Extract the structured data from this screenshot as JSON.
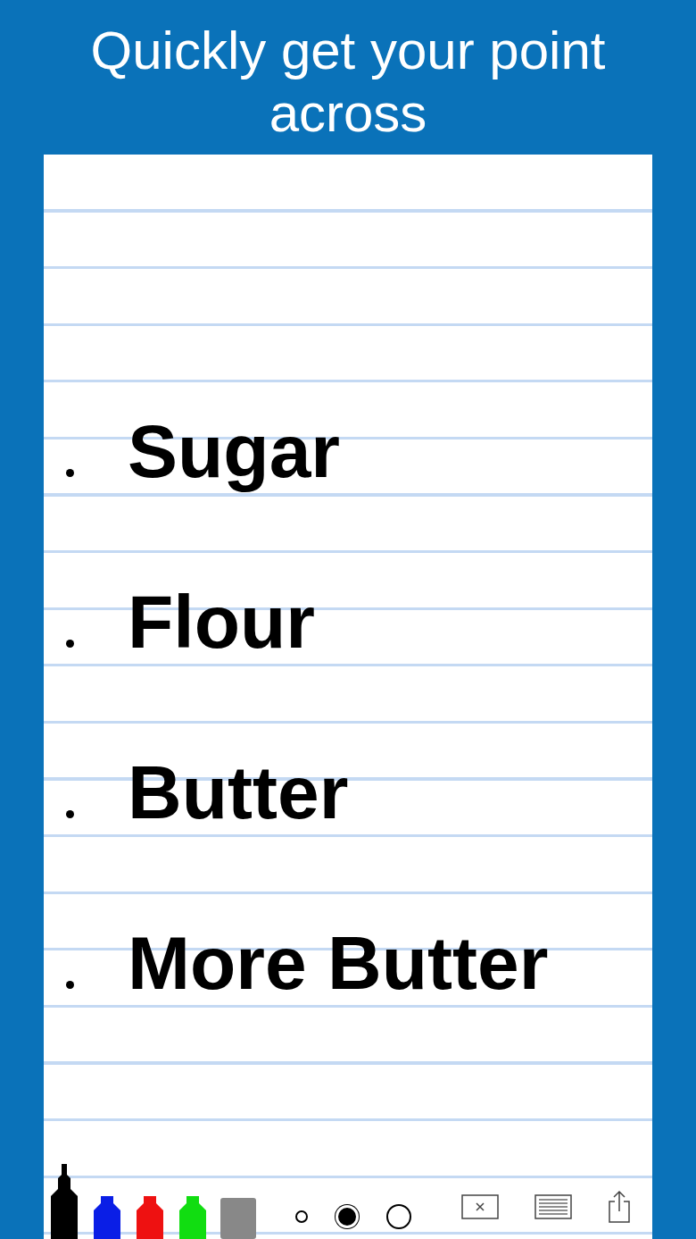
{
  "headline": "Quickly get your point across",
  "notes": [
    {
      "text": "Sugar"
    },
    {
      "text": "Flour"
    },
    {
      "text": "Butter"
    },
    {
      "text": "More Butter"
    }
  ],
  "tools": [
    {
      "kind": "marker",
      "color": "#000000",
      "selected": true
    },
    {
      "kind": "marker",
      "color": "#0a1ee6",
      "selected": false
    },
    {
      "kind": "marker",
      "color": "#ee1111",
      "selected": false
    },
    {
      "kind": "marker",
      "color": "#11dd11",
      "selected": false
    },
    {
      "kind": "eraser",
      "color": "#888888",
      "selected": false
    }
  ],
  "sizes": [
    {
      "selected": false
    },
    {
      "selected": true
    },
    {
      "selected": false
    }
  ],
  "actions": [
    {
      "kind": "clear"
    },
    {
      "kind": "paper"
    },
    {
      "kind": "share"
    }
  ]
}
